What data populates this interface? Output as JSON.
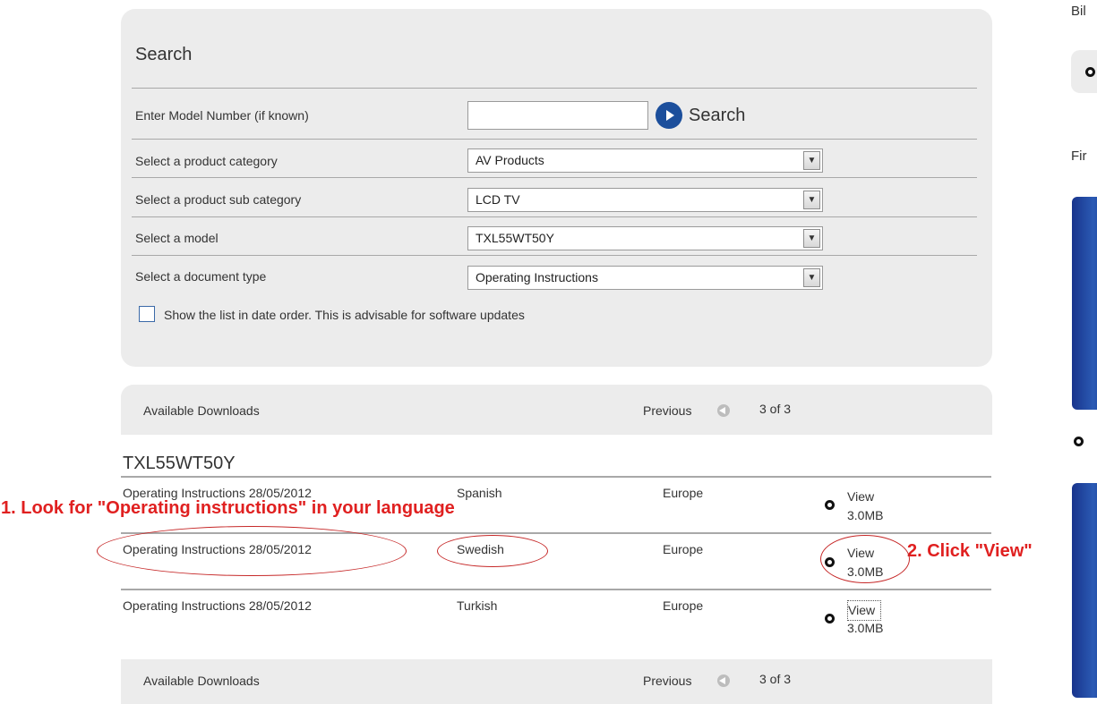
{
  "search": {
    "title": "Search",
    "model_label": "Enter Model Number (if known)",
    "model_value": "",
    "search_button": "Search",
    "category_label": "Select a product category",
    "category_value": "AV Products",
    "subcategory_label": "Select a product sub category",
    "subcategory_value": "LCD TV",
    "model_select_label": "Select a model",
    "model_select_value": "TXL55WT50Y",
    "doctype_label": "Select a document type",
    "doctype_value": "Operating Instructions",
    "date_order_label": "Show the list in date order. This is advisable for software updates"
  },
  "downloads": {
    "title": "Available Downloads",
    "previous_label": "Previous",
    "count": "3 of 3",
    "model_heading": "TXL55WT50Y",
    "rows": [
      {
        "doc": "Operating Instructions 28/05/2012",
        "language": "Spanish",
        "region": "Europe",
        "view": "View",
        "size": "3.0MB"
      },
      {
        "doc": "Operating Instructions 28/05/2012",
        "language": "Swedish",
        "region": "Europe",
        "view": "View",
        "size": "3.0MB"
      },
      {
        "doc": "Operating Instructions 28/05/2012",
        "language": "Turkish",
        "region": "Europe",
        "view": "View",
        "size": "3.0MB"
      }
    ]
  },
  "annotations": {
    "step1": "1. Look for \"Operating instructions\" in your language",
    "step2": "2. Click \"View\""
  },
  "sidebar": {
    "label_top": "Bil",
    "label_mid": "Fir"
  },
  "colors": {
    "panel_bg": "#ececec",
    "accent_blue": "#1c4f9c",
    "annotation_red": "#e02020"
  }
}
